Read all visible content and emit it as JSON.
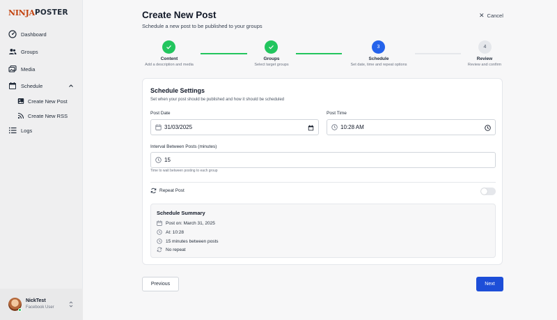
{
  "brand": {
    "name_part1": "NINJA",
    "name_part2": "POSTER",
    "accent": "#c2410c"
  },
  "sidebar": {
    "items": [
      {
        "label": "Dashboard",
        "icon": "gauge-icon"
      },
      {
        "label": "Groups",
        "icon": "users-icon"
      },
      {
        "label": "Media",
        "icon": "images-icon"
      },
      {
        "label": "Schedule",
        "icon": "calendar-icon",
        "expanded": true
      },
      {
        "label": "Create New Post",
        "icon": "image-icon",
        "sub": true
      },
      {
        "label": "Create New RSS",
        "icon": "rss-icon",
        "sub": true
      },
      {
        "label": "Logs",
        "icon": "list-icon"
      }
    ]
  },
  "user": {
    "name": "NickTest",
    "role": "Facebook User",
    "status_color": "#22c55e"
  },
  "header": {
    "title": "Create New Post",
    "subtitle": "Schedule a new post to be published to your groups",
    "cancel_label": "Cancel"
  },
  "stepper": {
    "steps": [
      {
        "number": "1",
        "label": "Content",
        "desc": "Add a description and media",
        "state": "done"
      },
      {
        "number": "2",
        "label": "Groups",
        "desc": "Select target groups",
        "state": "done"
      },
      {
        "number": "3",
        "label": "Schedule",
        "desc": "Set date, time and repeat options",
        "state": "active"
      },
      {
        "number": "4",
        "label": "Review",
        "desc": "Review and confirm",
        "state": "pending"
      }
    ]
  },
  "schedule": {
    "title": "Schedule Settings",
    "subtitle": "Set when your post should be published and how it should be scheduled",
    "post_date_label": "Post Date",
    "post_date_value": "31/03/2025",
    "post_time_label": "Post Time",
    "post_time_value": "10:28 AM",
    "interval_label": "Interval Between Posts (minutes)",
    "interval_value": "15",
    "interval_help": "Time to wait between posting to each group",
    "repeat_label": "Repeat Post",
    "repeat_enabled": false
  },
  "summary": {
    "title": "Schedule Summary",
    "post_on": "Post on: March 31, 2025",
    "at": "At: 10:28",
    "interval": "15 minutes between posts",
    "repeat": "No repeat"
  },
  "footer": {
    "previous_label": "Previous",
    "next_label": "Next"
  },
  "colors": {
    "done": "#22c55e",
    "active": "#2563eb",
    "primary_button": "#1d4ed8"
  }
}
